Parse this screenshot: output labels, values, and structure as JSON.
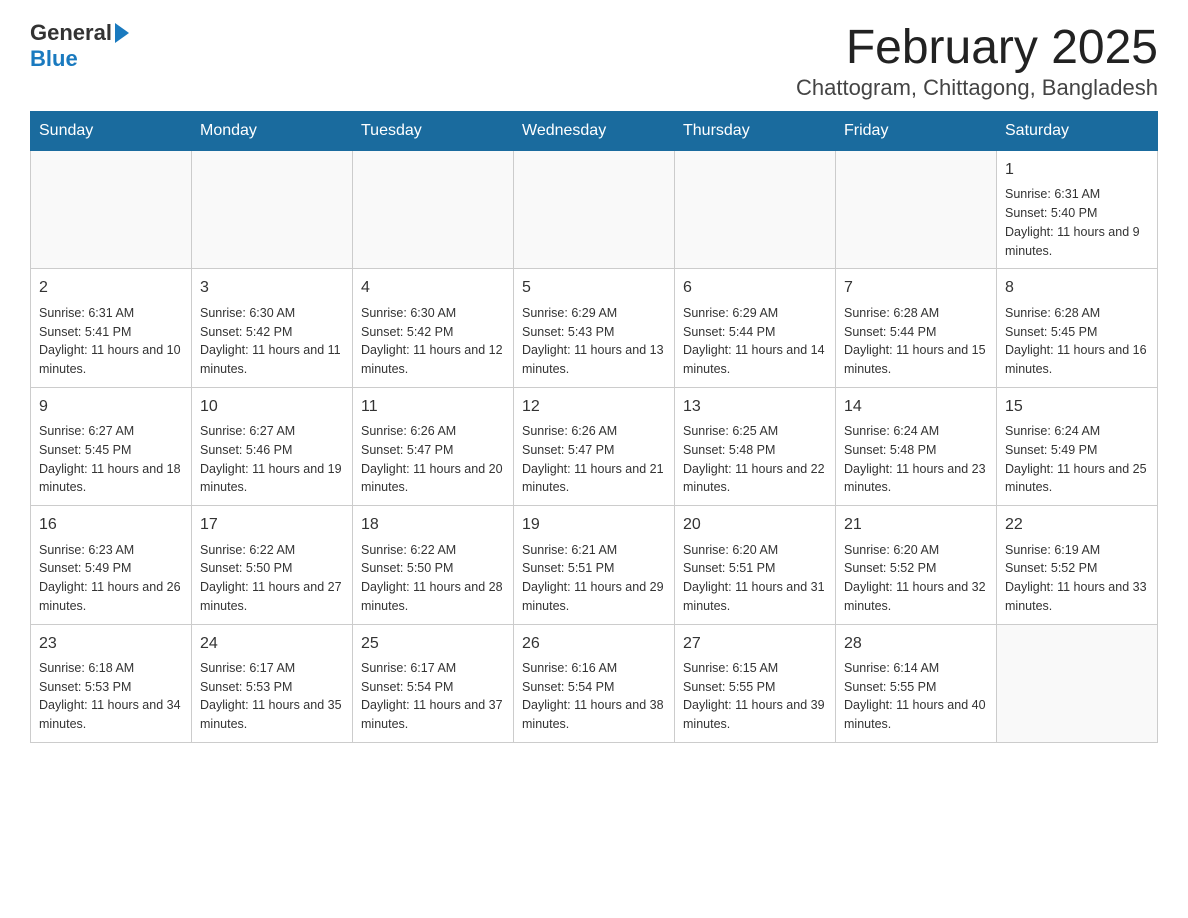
{
  "header": {
    "logo_general": "General",
    "logo_blue": "Blue",
    "month_title": "February 2025",
    "location": "Chattogram, Chittagong, Bangladesh"
  },
  "weekdays": [
    "Sunday",
    "Monday",
    "Tuesday",
    "Wednesday",
    "Thursday",
    "Friday",
    "Saturday"
  ],
  "weeks": [
    [
      {
        "day": "",
        "sunrise": "",
        "sunset": "",
        "daylight": "",
        "empty": true
      },
      {
        "day": "",
        "sunrise": "",
        "sunset": "",
        "daylight": "",
        "empty": true
      },
      {
        "day": "",
        "sunrise": "",
        "sunset": "",
        "daylight": "",
        "empty": true
      },
      {
        "day": "",
        "sunrise": "",
        "sunset": "",
        "daylight": "",
        "empty": true
      },
      {
        "day": "",
        "sunrise": "",
        "sunset": "",
        "daylight": "",
        "empty": true
      },
      {
        "day": "",
        "sunrise": "",
        "sunset": "",
        "daylight": "",
        "empty": true
      },
      {
        "day": "1",
        "sunrise": "Sunrise: 6:31 AM",
        "sunset": "Sunset: 5:40 PM",
        "daylight": "Daylight: 11 hours and 9 minutes.",
        "empty": false
      }
    ],
    [
      {
        "day": "2",
        "sunrise": "Sunrise: 6:31 AM",
        "sunset": "Sunset: 5:41 PM",
        "daylight": "Daylight: 11 hours and 10 minutes.",
        "empty": false
      },
      {
        "day": "3",
        "sunrise": "Sunrise: 6:30 AM",
        "sunset": "Sunset: 5:42 PM",
        "daylight": "Daylight: 11 hours and 11 minutes.",
        "empty": false
      },
      {
        "day": "4",
        "sunrise": "Sunrise: 6:30 AM",
        "sunset": "Sunset: 5:42 PM",
        "daylight": "Daylight: 11 hours and 12 minutes.",
        "empty": false
      },
      {
        "day": "5",
        "sunrise": "Sunrise: 6:29 AM",
        "sunset": "Sunset: 5:43 PM",
        "daylight": "Daylight: 11 hours and 13 minutes.",
        "empty": false
      },
      {
        "day": "6",
        "sunrise": "Sunrise: 6:29 AM",
        "sunset": "Sunset: 5:44 PM",
        "daylight": "Daylight: 11 hours and 14 minutes.",
        "empty": false
      },
      {
        "day": "7",
        "sunrise": "Sunrise: 6:28 AM",
        "sunset": "Sunset: 5:44 PM",
        "daylight": "Daylight: 11 hours and 15 minutes.",
        "empty": false
      },
      {
        "day": "8",
        "sunrise": "Sunrise: 6:28 AM",
        "sunset": "Sunset: 5:45 PM",
        "daylight": "Daylight: 11 hours and 16 minutes.",
        "empty": false
      }
    ],
    [
      {
        "day": "9",
        "sunrise": "Sunrise: 6:27 AM",
        "sunset": "Sunset: 5:45 PM",
        "daylight": "Daylight: 11 hours and 18 minutes.",
        "empty": false
      },
      {
        "day": "10",
        "sunrise": "Sunrise: 6:27 AM",
        "sunset": "Sunset: 5:46 PM",
        "daylight": "Daylight: 11 hours and 19 minutes.",
        "empty": false
      },
      {
        "day": "11",
        "sunrise": "Sunrise: 6:26 AM",
        "sunset": "Sunset: 5:47 PM",
        "daylight": "Daylight: 11 hours and 20 minutes.",
        "empty": false
      },
      {
        "day": "12",
        "sunrise": "Sunrise: 6:26 AM",
        "sunset": "Sunset: 5:47 PM",
        "daylight": "Daylight: 11 hours and 21 minutes.",
        "empty": false
      },
      {
        "day": "13",
        "sunrise": "Sunrise: 6:25 AM",
        "sunset": "Sunset: 5:48 PM",
        "daylight": "Daylight: 11 hours and 22 minutes.",
        "empty": false
      },
      {
        "day": "14",
        "sunrise": "Sunrise: 6:24 AM",
        "sunset": "Sunset: 5:48 PM",
        "daylight": "Daylight: 11 hours and 23 minutes.",
        "empty": false
      },
      {
        "day": "15",
        "sunrise": "Sunrise: 6:24 AM",
        "sunset": "Sunset: 5:49 PM",
        "daylight": "Daylight: 11 hours and 25 minutes.",
        "empty": false
      }
    ],
    [
      {
        "day": "16",
        "sunrise": "Sunrise: 6:23 AM",
        "sunset": "Sunset: 5:49 PM",
        "daylight": "Daylight: 11 hours and 26 minutes.",
        "empty": false
      },
      {
        "day": "17",
        "sunrise": "Sunrise: 6:22 AM",
        "sunset": "Sunset: 5:50 PM",
        "daylight": "Daylight: 11 hours and 27 minutes.",
        "empty": false
      },
      {
        "day": "18",
        "sunrise": "Sunrise: 6:22 AM",
        "sunset": "Sunset: 5:50 PM",
        "daylight": "Daylight: 11 hours and 28 minutes.",
        "empty": false
      },
      {
        "day": "19",
        "sunrise": "Sunrise: 6:21 AM",
        "sunset": "Sunset: 5:51 PM",
        "daylight": "Daylight: 11 hours and 29 minutes.",
        "empty": false
      },
      {
        "day": "20",
        "sunrise": "Sunrise: 6:20 AM",
        "sunset": "Sunset: 5:51 PM",
        "daylight": "Daylight: 11 hours and 31 minutes.",
        "empty": false
      },
      {
        "day": "21",
        "sunrise": "Sunrise: 6:20 AM",
        "sunset": "Sunset: 5:52 PM",
        "daylight": "Daylight: 11 hours and 32 minutes.",
        "empty": false
      },
      {
        "day": "22",
        "sunrise": "Sunrise: 6:19 AM",
        "sunset": "Sunset: 5:52 PM",
        "daylight": "Daylight: 11 hours and 33 minutes.",
        "empty": false
      }
    ],
    [
      {
        "day": "23",
        "sunrise": "Sunrise: 6:18 AM",
        "sunset": "Sunset: 5:53 PM",
        "daylight": "Daylight: 11 hours and 34 minutes.",
        "empty": false
      },
      {
        "day": "24",
        "sunrise": "Sunrise: 6:17 AM",
        "sunset": "Sunset: 5:53 PM",
        "daylight": "Daylight: 11 hours and 35 minutes.",
        "empty": false
      },
      {
        "day": "25",
        "sunrise": "Sunrise: 6:17 AM",
        "sunset": "Sunset: 5:54 PM",
        "daylight": "Daylight: 11 hours and 37 minutes.",
        "empty": false
      },
      {
        "day": "26",
        "sunrise": "Sunrise: 6:16 AM",
        "sunset": "Sunset: 5:54 PM",
        "daylight": "Daylight: 11 hours and 38 minutes.",
        "empty": false
      },
      {
        "day": "27",
        "sunrise": "Sunrise: 6:15 AM",
        "sunset": "Sunset: 5:55 PM",
        "daylight": "Daylight: 11 hours and 39 minutes.",
        "empty": false
      },
      {
        "day": "28",
        "sunrise": "Sunrise: 6:14 AM",
        "sunset": "Sunset: 5:55 PM",
        "daylight": "Daylight: 11 hours and 40 minutes.",
        "empty": false
      },
      {
        "day": "",
        "sunrise": "",
        "sunset": "",
        "daylight": "",
        "empty": true
      }
    ]
  ]
}
